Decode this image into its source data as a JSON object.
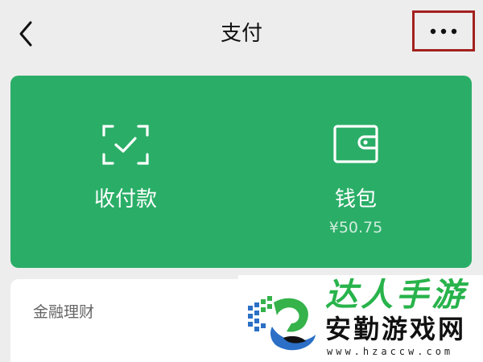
{
  "navbar": {
    "title": "支付",
    "back_icon": "chevron-left-icon",
    "more_icon": "more-dots-icon",
    "highlight_color": "#a3211e"
  },
  "pay_card": {
    "background": "#2aae67",
    "items": [
      {
        "label": "收付款",
        "icon": "scan-check-icon"
      },
      {
        "label": "钱包",
        "sub": "¥50.75",
        "icon": "wallet-icon"
      }
    ]
  },
  "finance": {
    "title": "金融理财"
  },
  "watermark": {
    "top": "达人手游",
    "middle": "安勤游戏网",
    "url": "www.hzaccw.com"
  }
}
